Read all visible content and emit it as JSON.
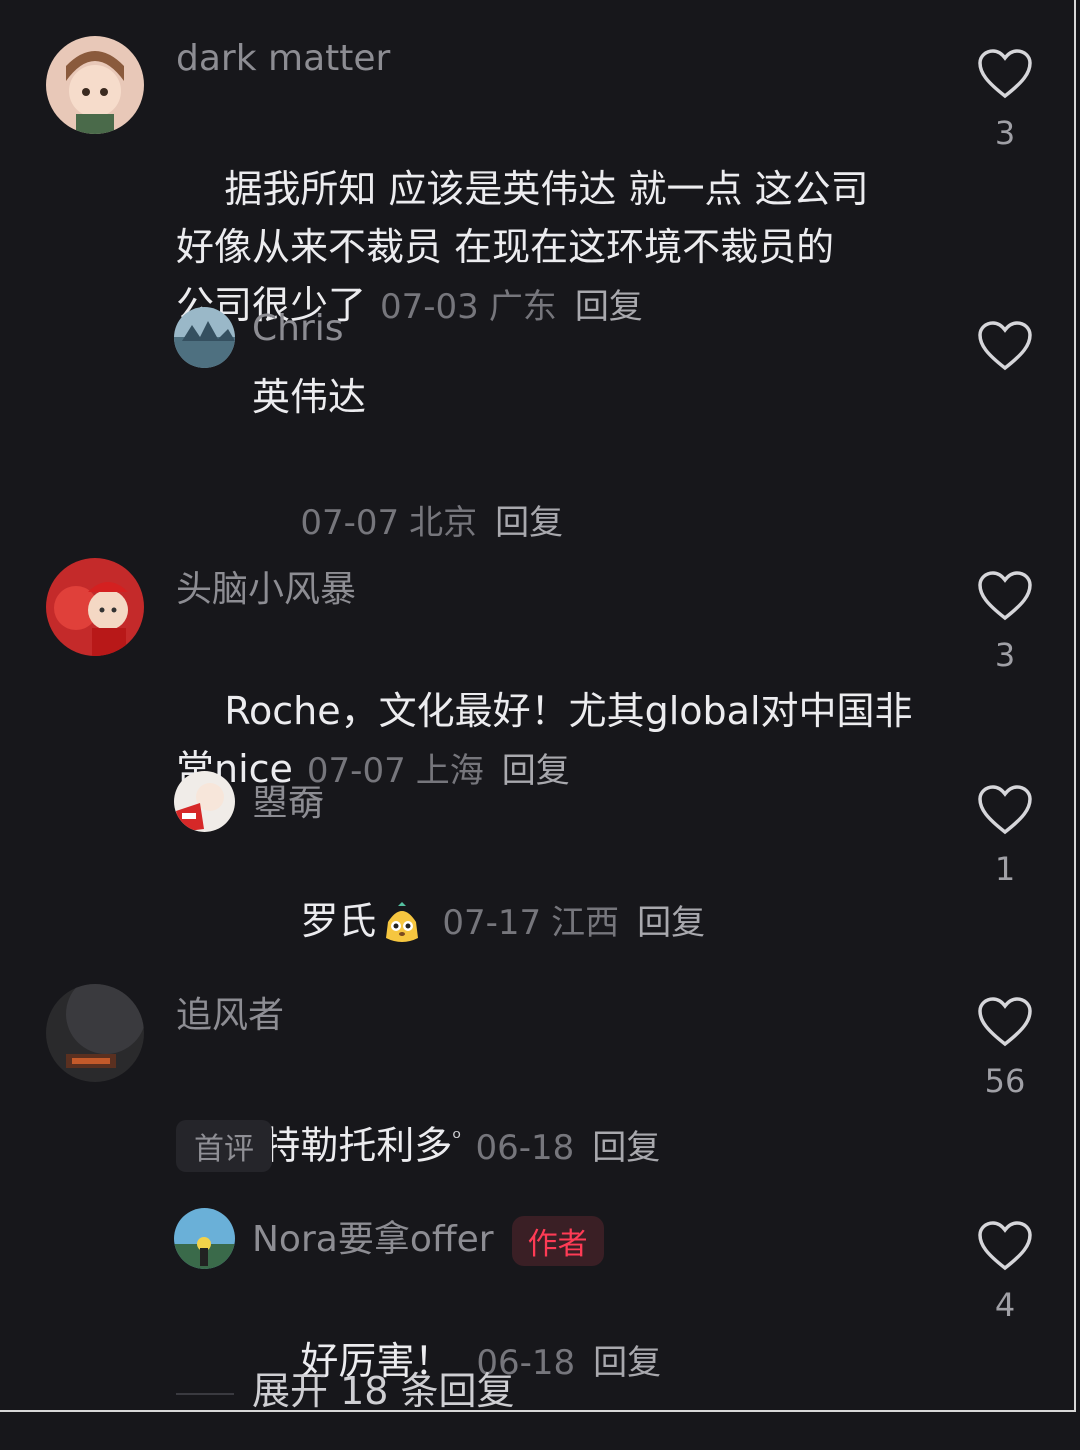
{
  "comments": [
    {
      "name": "dark matter",
      "text": "据我所知 应该是英伟达 就一点 这公司\n好像从来不裁员 在现在这环境不裁员的\n公司很少了",
      "date": "07-03",
      "location": "广东",
      "reply": "回复",
      "likes": "3",
      "avatar": "cartoon-girl-avatar"
    },
    {
      "name": "Chris",
      "text": "英伟达",
      "date": "07-07",
      "location": "北京",
      "reply": "回复",
      "likes": "",
      "avatar": "landscape-avatar"
    },
    {
      "name": "头脑小风暴",
      "text": "Roche，文化最好！尤其global对中国非\n常nice",
      "date": "07-07",
      "location": "上海",
      "reply": "回复",
      "likes": "3",
      "avatar": "red-dragon-avatar"
    },
    {
      "name": "曌奣",
      "text": "罗氏",
      "date": "07-17",
      "location": "江西",
      "reply": "回复",
      "likes": "1",
      "avatar": "white-figure-avatar",
      "emoji": "meerkat-emoji"
    },
    {
      "name": "追风者",
      "text": "梅特勒托利多",
      "date": "06-18",
      "location": "",
      "reply": "回复",
      "likes": "56",
      "avatar": "night-scene-avatar",
      "tag": "首评"
    },
    {
      "name": "Nora要拿offer",
      "author_tag": "作者",
      "text": "好厉害！",
      "date": "06-18",
      "location": "",
      "reply": "回复",
      "likes": "4",
      "avatar": "beach-avatar"
    }
  ],
  "expand_label": "展开 18 条回复",
  "colors": {
    "background": "#17171b",
    "author_tag": "#ff3b55"
  }
}
